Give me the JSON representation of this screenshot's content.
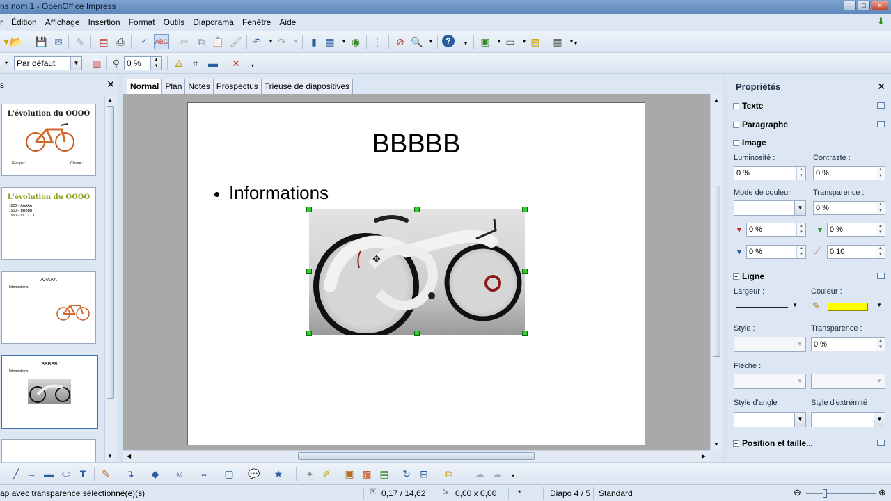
{
  "window": {
    "title": "ns nom 1 - OpenOffice Impress"
  },
  "menu": [
    "r",
    "Édition",
    "Affichage",
    "Insertion",
    "Format",
    "Outils",
    "Diaporama",
    "Fenêtre",
    "Aide"
  ],
  "toolbar2": {
    "style_value": "Par défaut",
    "transparency_value": "0 %"
  },
  "slide_panel": {
    "title": "s",
    "thumbs": [
      {
        "title": "L'évolution du OOOO",
        "bullets": [
          "Groupe :",
          "Classe :"
        ]
      },
      {
        "title": "L'évolution du OOOO",
        "bullets": [
          "1800 – AAAAA",
          "1900 – BBBBB",
          "1950 – CCCCCC"
        ]
      },
      {
        "title": "AAAAA",
        "bullets": [
          "Informations"
        ]
      },
      {
        "title": "BBBBB",
        "bullets": [
          "Informations"
        ]
      }
    ]
  },
  "view_tabs": [
    "Normal",
    "Plan",
    "Notes",
    "Prospectus",
    "Trieuse de diapositives"
  ],
  "slide": {
    "title": "BBBBB",
    "bullet": "Informations"
  },
  "properties": {
    "header": "Propriétés",
    "sections": {
      "texte": "Texte",
      "paragraphe": "Paragraphe",
      "image": "Image",
      "ligne": "Ligne",
      "position": "Position et taille..."
    },
    "image": {
      "luminosity_label": "Luminosité :",
      "luminosity": "0 %",
      "contrast_label": "Contraste :",
      "contrast": "0 %",
      "color_mode_label": "Mode de couleur :",
      "transparency_label": "Transparence :",
      "transparency": "0 %",
      "red": "0 %",
      "green": "0 %",
      "blue": "0 %",
      "gamma": "0,10"
    },
    "ligne": {
      "width_label": "Largeur :",
      "color_label": "Couleur :",
      "color": "#ffff00",
      "style_label": "Style :",
      "transparency_label": "Transparence :",
      "transparency": "0 %",
      "arrow_label": "Flèche :",
      "angle_label": "Style d'angle",
      "end_label": "Style d'extrémité"
    }
  },
  "status": {
    "message": "ap avec transparence sélectionné(e)(s)",
    "position": "0,17 / 14,62",
    "size": "0,00 x 0,00",
    "modified": "*",
    "slide": "Diapo 4 / 5",
    "layout": "Standard"
  },
  "colors": {
    "selection_handle": "#33cc33",
    "accent": "#3b6fb6"
  }
}
